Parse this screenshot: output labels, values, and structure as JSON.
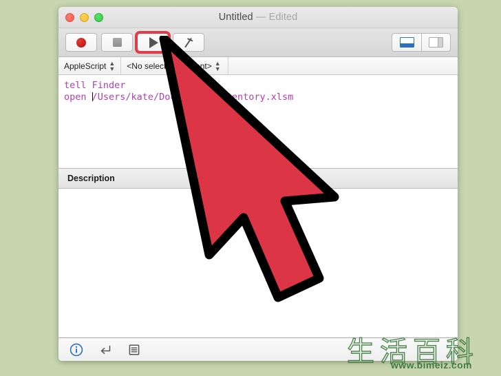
{
  "desktop": {
    "background_color": "#c7d6af"
  },
  "window": {
    "title_main": "Untitled",
    "title_separator": "—",
    "title_state": "Edited",
    "traffic_lights": [
      {
        "name": "close",
        "color": "#ef5e52"
      },
      {
        "name": "minimize",
        "color": "#f2bb2e"
      },
      {
        "name": "zoom",
        "color": "#36c945"
      }
    ]
  },
  "toolbar": {
    "buttons": [
      {
        "name": "record-button",
        "icon": "record-circle-icon",
        "label": "Record",
        "highlighted": false
      },
      {
        "name": "stop-button",
        "icon": "stop-square-icon",
        "label": "Stop",
        "highlighted": false
      },
      {
        "name": "run-button",
        "icon": "run-triangle-icon",
        "label": "Run",
        "highlighted": true
      },
      {
        "name": "compile-button",
        "icon": "hammer-icon",
        "label": "Compile",
        "highlighted": false
      }
    ],
    "highlight_color": "#e03c4b",
    "view_toggles": [
      {
        "name": "bottom-panel-toggle",
        "icon": "bottom-panel-icon",
        "active": true,
        "color": "#2a6fc4"
      },
      {
        "name": "side-panel-toggle",
        "icon": "side-panel-icon",
        "active": false,
        "color": "#a9a9a9"
      }
    ]
  },
  "navbar": {
    "language": "AppleScript",
    "element": "<No selected element>"
  },
  "editor": {
    "code_line_1": "tell Finder",
    "code_line_2_before_caret": "open ",
    "code_line_2_after_caret": "/Users/kate/Documents/inventory.xlsm",
    "text_color": "#b03fb0"
  },
  "description_panel": {
    "tab_label": "Description",
    "content": ""
  },
  "bottombar": {
    "icons": [
      {
        "name": "info-icon",
        "label": "Description",
        "color": "#2a6fc4"
      },
      {
        "name": "return-arrow-icon",
        "label": "Result",
        "color": "#555555"
      },
      {
        "name": "event-log-icon",
        "label": "Event Log",
        "color": "#555555"
      }
    ]
  },
  "cursor": {
    "name": "mouse-pointer",
    "fill": "#dc3545",
    "stroke": "#000000"
  },
  "watermark": {
    "characters": "生活百科",
    "url": "www.bimeiz.com",
    "color": "#3f7c3f"
  }
}
